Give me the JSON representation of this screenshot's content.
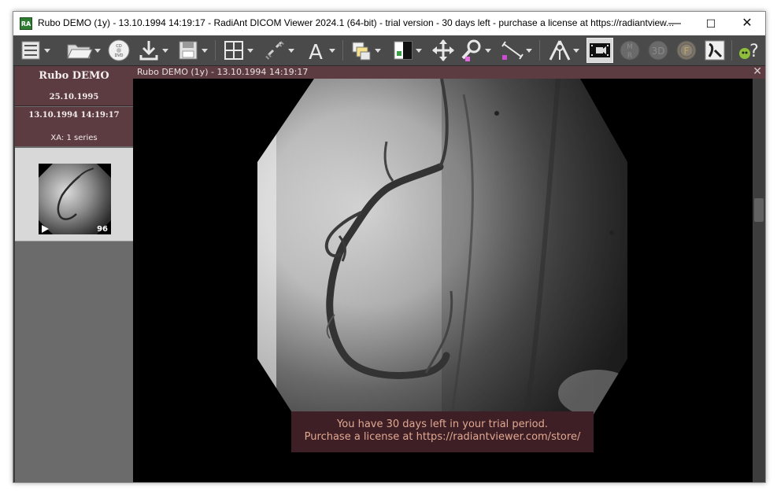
{
  "window": {
    "title": "Rubo DEMO (1y) - 13.10.1994 14:19:17 - RadiAnt DICOM Viewer 2024.1 (64-bit) - trial version - 30 days left - purchase a license at https://radiantview...",
    "app_icon_text": "RA",
    "minimize": "—",
    "maximize": "☐",
    "close": "✕"
  },
  "toolbar": {
    "icons": [
      "open-study-list-icon",
      "open-folder-icon",
      "cd-dvd-icon",
      "download-icon",
      "save-icon",
      "layout-grid-icon",
      "link-icon",
      "annotation-text-icon",
      "series-compare-icon",
      "window-level-icon",
      "pan-icon",
      "zoom-icon",
      "measure-ruler-icon",
      "mpr-icon",
      "cine-icon",
      "mr-icon",
      "3d-icon",
      "fusion-icon",
      "curve-icon",
      "help-icon"
    ],
    "cd_label": "CD\nDVD"
  },
  "patient": {
    "name": "Rubo DEMO",
    "birth_date": "25.10.1995"
  },
  "study": {
    "datetime": "13.10.1994 14:19:17",
    "series_summary": "XA: 1 series"
  },
  "series": {
    "frame_count": "96",
    "play_icon": "play-icon"
  },
  "viewer": {
    "title": "Rubo DEMO  (1y) - 13.10.1994 14:19:17",
    "close_glyph": "✕"
  },
  "trial_message": {
    "line1": "You have 30 days left in your trial period.",
    "line2": "Purchase a license at https://radiantviewer.com/store/"
  },
  "colors": {
    "title_bar": "#ffffff",
    "toolbar": "#4a4a4a",
    "panel": "#6b6b6b",
    "card": "#5c3c41",
    "trial_bg": "#3e1f26",
    "trial_text": "#e0a890"
  }
}
